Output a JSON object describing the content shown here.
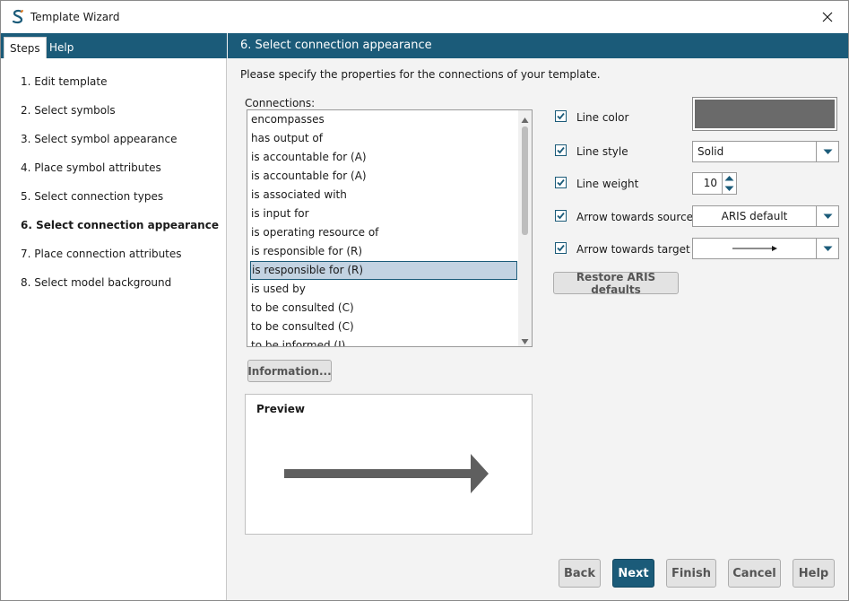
{
  "window": {
    "title": "Template Wizard",
    "icon": "aris-s-logo-icon",
    "close_icon": "close-icon"
  },
  "left_tabs": {
    "steps_label": "Steps",
    "help_label": "Help"
  },
  "steps": [
    {
      "label": "1. Edit template",
      "active": false
    },
    {
      "label": "2. Select symbols",
      "active": false
    },
    {
      "label": "3. Select symbol appearance",
      "active": false
    },
    {
      "label": "4. Place symbol attributes",
      "active": false
    },
    {
      "label": "5. Select connection types",
      "active": false
    },
    {
      "label": "6. Select connection appearance",
      "active": true
    },
    {
      "label": "7. Place connection attributes",
      "active": false
    },
    {
      "label": "8. Select model background",
      "active": false
    }
  ],
  "header": {
    "title": "6. Select connection appearance"
  },
  "instruction": "Please specify the properties for the connections of your template.",
  "connections": {
    "label": "Connections:",
    "items": [
      "encompasses",
      "has output of",
      "is accountable for (A)",
      "is accountable for (A)",
      "is associated with",
      "is input for",
      "is operating resource of",
      "is responsible for (R)",
      "is responsible for (R)",
      "is used by",
      "to be consulted (C)",
      "to be consulted (C)",
      "to be informed (I)"
    ],
    "selected_index": 8
  },
  "information_button": "Information...",
  "preview": {
    "title": "Preview",
    "arrow_color": "#5f5f5f"
  },
  "properties": {
    "line_color": {
      "label": "Line color",
      "checked": true,
      "value": "#6a6a6a"
    },
    "line_style": {
      "label": "Line style",
      "checked": true,
      "value": "Solid"
    },
    "line_weight": {
      "label": "Line weight",
      "checked": true,
      "value": "10"
    },
    "arrow_source": {
      "label": "Arrow towards source",
      "checked": true,
      "value": "ARIS default"
    },
    "arrow_target": {
      "label": "Arrow towards target",
      "checked": true,
      "value_icon": "arrow-right-icon"
    }
  },
  "restore_button": "Restore ARIS defaults",
  "footer": {
    "back": "Back",
    "next": "Next",
    "finish": "Finish",
    "cancel": "Cancel",
    "help": "Help"
  },
  "colors": {
    "accent": "#1b5b79",
    "selection": "#c3d3e2"
  }
}
